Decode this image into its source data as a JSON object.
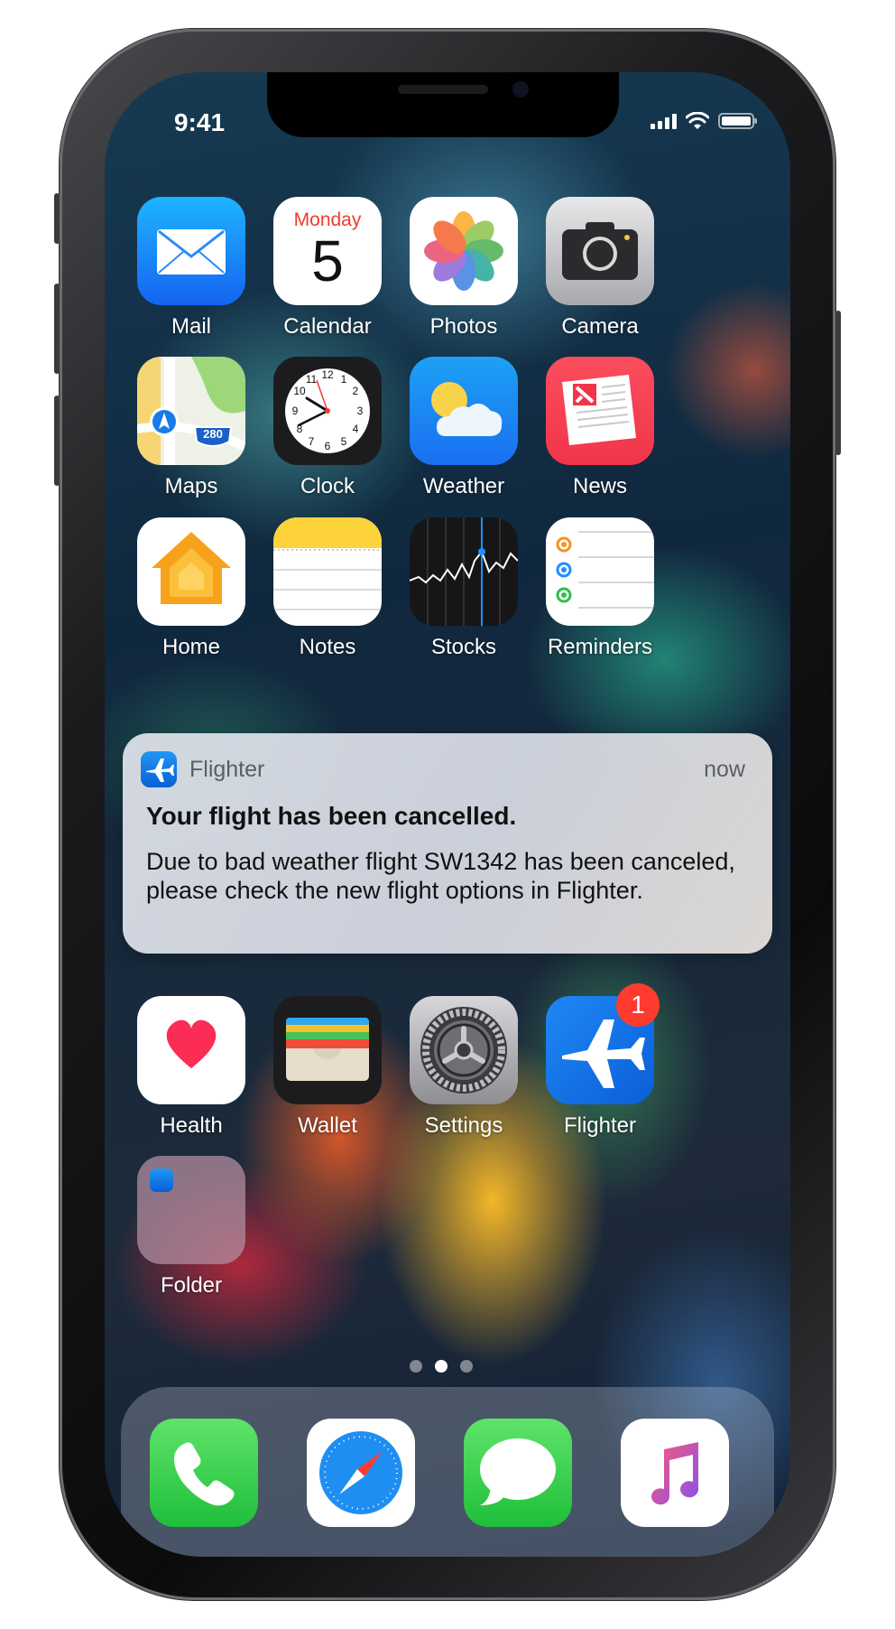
{
  "status_bar": {
    "time": "9:41"
  },
  "calendar_icon": {
    "day_name": "Monday",
    "day_number": "5"
  },
  "maps_icon": {
    "highway": "280"
  },
  "home_row_1": [
    {
      "label": "Mail",
      "icon": "mail-icon"
    },
    {
      "label": "Calendar",
      "icon": "calendar-icon"
    },
    {
      "label": "Photos",
      "icon": "photos-icon"
    },
    {
      "label": "Camera",
      "icon": "camera-icon"
    }
  ],
  "home_row_2": [
    {
      "label": "Maps",
      "icon": "maps-icon"
    },
    {
      "label": "Clock",
      "icon": "clock-icon"
    },
    {
      "label": "Weather",
      "icon": "weather-icon"
    },
    {
      "label": "News",
      "icon": "news-icon"
    }
  ],
  "home_row_3": [
    {
      "label": "Home",
      "icon": "home-icon"
    },
    {
      "label": "Notes",
      "icon": "notes-icon"
    },
    {
      "label": "Stocks",
      "icon": "stocks-icon"
    },
    {
      "label": "Reminders",
      "icon": "reminders-icon"
    }
  ],
  "home_row_4": [
    {
      "label": "Health",
      "icon": "health-icon"
    },
    {
      "label": "Wallet",
      "icon": "wallet-icon"
    },
    {
      "label": "Settings",
      "icon": "settings-icon"
    },
    {
      "label": "Flighter",
      "icon": "flighter-icon",
      "badge": "1"
    }
  ],
  "folder": {
    "label": "Folder"
  },
  "notification": {
    "app_name": "Flighter",
    "time": "now",
    "title": "Your flight has been cancelled.",
    "body": "Due to bad weather flight SW1342 has been canceled, please check the new flight options in Flighter."
  },
  "page_indicator": {
    "pages": 3,
    "current": 2
  },
  "dock": [
    {
      "icon": "phone-icon"
    },
    {
      "icon": "safari-icon"
    },
    {
      "icon": "messages-icon"
    },
    {
      "icon": "music-icon"
    }
  ],
  "colors": {
    "badge": "#ff3b30",
    "flighter_blue": "#1a82f0"
  }
}
